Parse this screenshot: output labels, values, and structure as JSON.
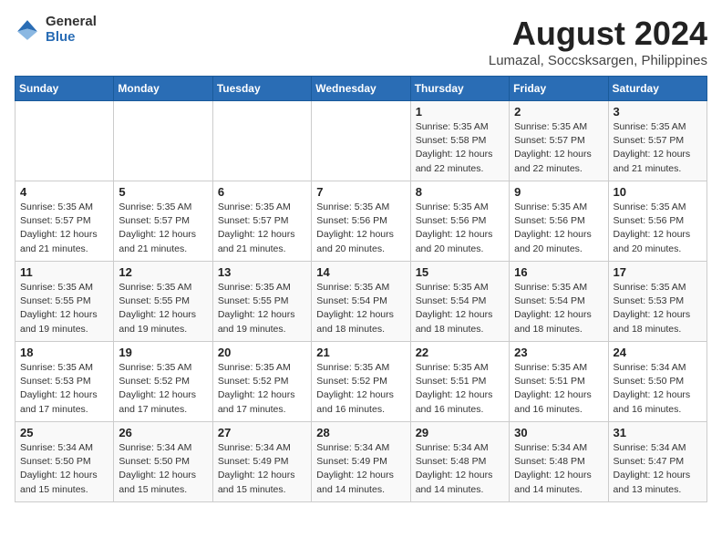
{
  "logo": {
    "general": "General",
    "blue": "Blue"
  },
  "title": {
    "month_year": "August 2024",
    "location": "Lumazal, Soccsksargen, Philippines"
  },
  "headers": [
    "Sunday",
    "Monday",
    "Tuesday",
    "Wednesday",
    "Thursday",
    "Friday",
    "Saturday"
  ],
  "weeks": [
    [
      {
        "day": "",
        "info": ""
      },
      {
        "day": "",
        "info": ""
      },
      {
        "day": "",
        "info": ""
      },
      {
        "day": "",
        "info": ""
      },
      {
        "day": "1",
        "info": "Sunrise: 5:35 AM\nSunset: 5:58 PM\nDaylight: 12 hours\nand 22 minutes."
      },
      {
        "day": "2",
        "info": "Sunrise: 5:35 AM\nSunset: 5:57 PM\nDaylight: 12 hours\nand 22 minutes."
      },
      {
        "day": "3",
        "info": "Sunrise: 5:35 AM\nSunset: 5:57 PM\nDaylight: 12 hours\nand 21 minutes."
      }
    ],
    [
      {
        "day": "4",
        "info": "Sunrise: 5:35 AM\nSunset: 5:57 PM\nDaylight: 12 hours\nand 21 minutes."
      },
      {
        "day": "5",
        "info": "Sunrise: 5:35 AM\nSunset: 5:57 PM\nDaylight: 12 hours\nand 21 minutes."
      },
      {
        "day": "6",
        "info": "Sunrise: 5:35 AM\nSunset: 5:57 PM\nDaylight: 12 hours\nand 21 minutes."
      },
      {
        "day": "7",
        "info": "Sunrise: 5:35 AM\nSunset: 5:56 PM\nDaylight: 12 hours\nand 20 minutes."
      },
      {
        "day": "8",
        "info": "Sunrise: 5:35 AM\nSunset: 5:56 PM\nDaylight: 12 hours\nand 20 minutes."
      },
      {
        "day": "9",
        "info": "Sunrise: 5:35 AM\nSunset: 5:56 PM\nDaylight: 12 hours\nand 20 minutes."
      },
      {
        "day": "10",
        "info": "Sunrise: 5:35 AM\nSunset: 5:56 PM\nDaylight: 12 hours\nand 20 minutes."
      }
    ],
    [
      {
        "day": "11",
        "info": "Sunrise: 5:35 AM\nSunset: 5:55 PM\nDaylight: 12 hours\nand 19 minutes."
      },
      {
        "day": "12",
        "info": "Sunrise: 5:35 AM\nSunset: 5:55 PM\nDaylight: 12 hours\nand 19 minutes."
      },
      {
        "day": "13",
        "info": "Sunrise: 5:35 AM\nSunset: 5:55 PM\nDaylight: 12 hours\nand 19 minutes."
      },
      {
        "day": "14",
        "info": "Sunrise: 5:35 AM\nSunset: 5:54 PM\nDaylight: 12 hours\nand 18 minutes."
      },
      {
        "day": "15",
        "info": "Sunrise: 5:35 AM\nSunset: 5:54 PM\nDaylight: 12 hours\nand 18 minutes."
      },
      {
        "day": "16",
        "info": "Sunrise: 5:35 AM\nSunset: 5:54 PM\nDaylight: 12 hours\nand 18 minutes."
      },
      {
        "day": "17",
        "info": "Sunrise: 5:35 AM\nSunset: 5:53 PM\nDaylight: 12 hours\nand 18 minutes."
      }
    ],
    [
      {
        "day": "18",
        "info": "Sunrise: 5:35 AM\nSunset: 5:53 PM\nDaylight: 12 hours\nand 17 minutes."
      },
      {
        "day": "19",
        "info": "Sunrise: 5:35 AM\nSunset: 5:52 PM\nDaylight: 12 hours\nand 17 minutes."
      },
      {
        "day": "20",
        "info": "Sunrise: 5:35 AM\nSunset: 5:52 PM\nDaylight: 12 hours\nand 17 minutes."
      },
      {
        "day": "21",
        "info": "Sunrise: 5:35 AM\nSunset: 5:52 PM\nDaylight: 12 hours\nand 16 minutes."
      },
      {
        "day": "22",
        "info": "Sunrise: 5:35 AM\nSunset: 5:51 PM\nDaylight: 12 hours\nand 16 minutes."
      },
      {
        "day": "23",
        "info": "Sunrise: 5:35 AM\nSunset: 5:51 PM\nDaylight: 12 hours\nand 16 minutes."
      },
      {
        "day": "24",
        "info": "Sunrise: 5:34 AM\nSunset: 5:50 PM\nDaylight: 12 hours\nand 16 minutes."
      }
    ],
    [
      {
        "day": "25",
        "info": "Sunrise: 5:34 AM\nSunset: 5:50 PM\nDaylight: 12 hours\nand 15 minutes."
      },
      {
        "day": "26",
        "info": "Sunrise: 5:34 AM\nSunset: 5:50 PM\nDaylight: 12 hours\nand 15 minutes."
      },
      {
        "day": "27",
        "info": "Sunrise: 5:34 AM\nSunset: 5:49 PM\nDaylight: 12 hours\nand 15 minutes."
      },
      {
        "day": "28",
        "info": "Sunrise: 5:34 AM\nSunset: 5:49 PM\nDaylight: 12 hours\nand 14 minutes."
      },
      {
        "day": "29",
        "info": "Sunrise: 5:34 AM\nSunset: 5:48 PM\nDaylight: 12 hours\nand 14 minutes."
      },
      {
        "day": "30",
        "info": "Sunrise: 5:34 AM\nSunset: 5:48 PM\nDaylight: 12 hours\nand 14 minutes."
      },
      {
        "day": "31",
        "info": "Sunrise: 5:34 AM\nSunset: 5:47 PM\nDaylight: 12 hours\nand 13 minutes."
      }
    ]
  ]
}
